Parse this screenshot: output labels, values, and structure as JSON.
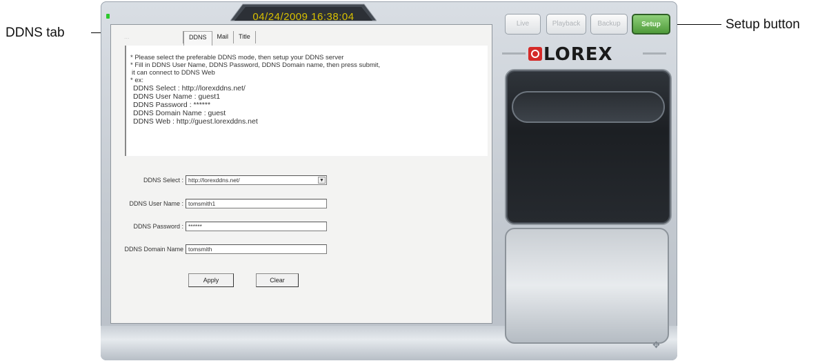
{
  "callouts": {
    "ddns_tab": "DDNS tab",
    "setup_button": "Setup button"
  },
  "header": {
    "datetime": "04/24/2009 16:38:04"
  },
  "tabs": {
    "hidden": "...",
    "ddns": "DDNS",
    "mail": "Mail",
    "title": "Title"
  },
  "info": {
    "line1": "* Please select the preferable DDNS mode, then setup your DDNS server",
    "line2": "* Fill in DDNS User Name, DDNS Password, DDNS Domain name, then press submit,",
    "line3": "it can connect to DDNS Web",
    "line4": "* ex:",
    "line5": "DDNS Select : http://lorexddns.net/",
    "line6": "DDNS User Name : guest1",
    "line7": "DDNS Password : ******",
    "line8": "DDNS Domain Name : guest",
    "line9": "DDNS Web : http://guest.lorexddns.net"
  },
  "form": {
    "select_label": "DDNS Select :",
    "select_value": "http://lorexddns.net/",
    "username_label": "DDNS User Name :",
    "username_value": "tomsmith1",
    "password_label": "DDNS Password :",
    "password_value": "******",
    "domain_label": "DDNS Domain Name",
    "domain_value": "tomsmith"
  },
  "buttons": {
    "apply": "Apply",
    "clear": "Clear"
  },
  "nav": {
    "live": "Live",
    "playback": "Playback",
    "backup": "Backup",
    "setup": "Setup"
  },
  "brand": {
    "logo": "LOREX",
    "accent": "#d52a28"
  },
  "colors": {
    "setup_active": "#4f9a3a",
    "date_text": "#d8c000"
  }
}
